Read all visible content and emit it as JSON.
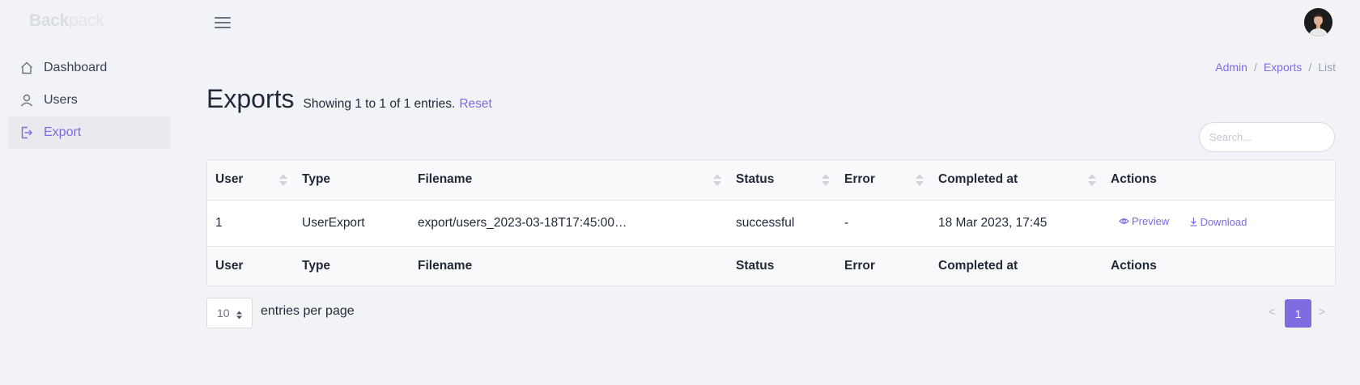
{
  "brand": {
    "part1": "Back",
    "part2": "pack"
  },
  "sidebar": {
    "items": [
      {
        "label": "Dashboard",
        "icon": "home-icon"
      },
      {
        "label": "Users",
        "icon": "user-icon"
      },
      {
        "label": "Export",
        "icon": "export-icon",
        "active": true
      }
    ]
  },
  "breadcrumb": [
    "Admin",
    "Exports",
    "List"
  ],
  "page": {
    "title": "Exports",
    "entries_info": "Showing 1 to 1 of 1 entries.",
    "reset_label": "Reset"
  },
  "search": {
    "placeholder": "Search..."
  },
  "table": {
    "columns": [
      "User",
      "Type",
      "Filename",
      "Status",
      "Error",
      "Completed at",
      "Actions"
    ],
    "rows": [
      {
        "user": "1",
        "type": "UserExport",
        "filename": "export/users_2023-03-18T17:45:00…",
        "status": "successful",
        "error": "-",
        "completed_at": "18 Mar 2023, 17:45",
        "actions": [
          "Preview",
          "Download"
        ]
      }
    ]
  },
  "footer": {
    "per_page_value": "10",
    "per_page_label": "entries per page",
    "pagination": {
      "prev": "<",
      "current": "1",
      "next": ">"
    }
  },
  "colors": {
    "accent": "#7c6ce0",
    "background": "#f2f3f7"
  }
}
